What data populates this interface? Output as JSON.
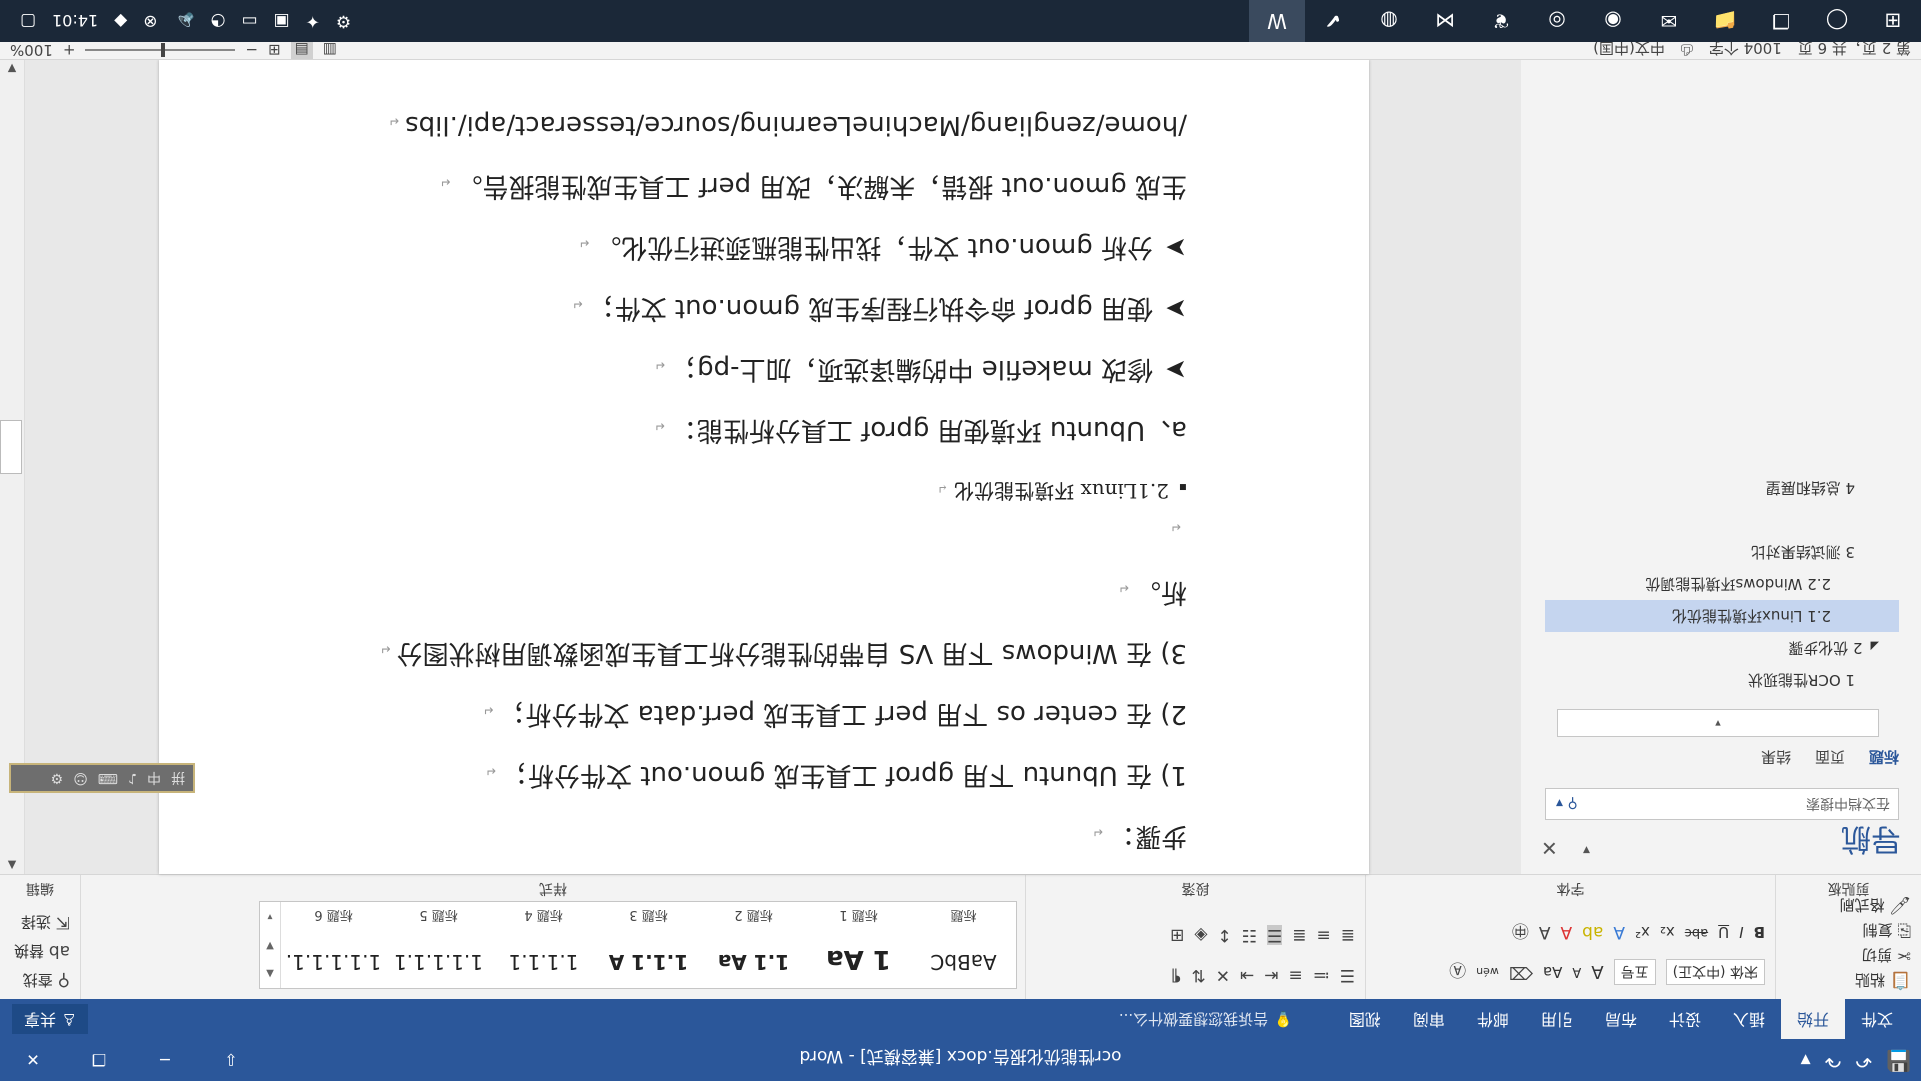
{
  "window": {
    "title": "ocr性能优化报告.docx [兼容模式] - Word",
    "qat_icons": [
      "save-icon",
      "undo-icon",
      "redo-icon",
      "customize-icon"
    ],
    "buttons": {
      "minimize": "─",
      "restore": "❐",
      "close": "✕",
      "ribbon_display": "⇩"
    }
  },
  "ribbon_tabs": {
    "tabs": [
      "文件",
      "开始",
      "插入",
      "设计",
      "布局",
      "引用",
      "邮件",
      "审阅",
      "视图"
    ],
    "active": "开始",
    "tell_me": "告诉我您想要做什么...",
    "share": "共享"
  },
  "ribbon": {
    "clipboard": {
      "label": "剪贴板",
      "paste": "粘贴",
      "cut": "剪切",
      "copy": "复制",
      "format_painter": "格式刷"
    },
    "font": {
      "label": "字体",
      "font_name": "宋体 (中文正)",
      "font_size": "五号",
      "grow": "A",
      "shrink": "A",
      "case": "Aa",
      "bold": "B",
      "italic": "I",
      "underline": "U",
      "strike": "abc",
      "sub": "x₂",
      "sup": "x²",
      "wen": "wén"
    },
    "paragraph": {
      "label": "段落"
    },
    "styles": {
      "label": "样式",
      "items": [
        {
          "preview": "AaBbC",
          "name": "标题"
        },
        {
          "preview": "1 Aa",
          "name": "标题 1"
        },
        {
          "preview": "1.1 Aa",
          "name": "标题 2"
        },
        {
          "preview": "1.1.1 A",
          "name": "标题 3"
        },
        {
          "preview": "1.1.1.1",
          "name": "标题 4"
        },
        {
          "preview": "1.1.1.1.1",
          "name": "标题 5"
        },
        {
          "preview": "1.1.1.1.1.",
          "name": "标题 6"
        }
      ]
    },
    "editing": {
      "label": "编辑",
      "find": "查找",
      "replace": "替换",
      "select": "选择"
    }
  },
  "nav_pane": {
    "title": "导航",
    "search_placeholder": "在文档中搜索",
    "tabs": [
      "标题",
      "页面",
      "结果"
    ],
    "active_tab": "标题",
    "dropdown_arrow": "▾",
    "tree": [
      {
        "label": "1 OCR性能现状",
        "indent": 1,
        "selected": false
      },
      {
        "label": "2 优化步骤",
        "indent": 0,
        "selected": false,
        "expander": "◢"
      },
      {
        "label": "2.1 Linux环境性能优化",
        "indent": 2,
        "selected": true
      },
      {
        "label": "2.2 Windows环境性能调优",
        "indent": 2,
        "selected": false
      },
      {
        "label": "3 测试结果对比",
        "indent": 1,
        "selected": false
      },
      {
        "label": "",
        "indent": 1,
        "selected": false
      },
      {
        "label": "4 总结和展望",
        "indent": 1,
        "selected": false
      }
    ]
  },
  "document": {
    "paragraphs": [
      {
        "text": "步骤：",
        "type": "p"
      },
      {
        "text": "1) 在 Ubuntu 下用 gprof 工具生成 gmon.out 文件分析；",
        "type": "p"
      },
      {
        "text": "2) 在 center os 下用 perf 工具生成 perf.data 文件分析；",
        "type": "p"
      },
      {
        "text": "3) 在 Windows 下用 VS 自带的性能分析工具生成函数调用树状图分",
        "type": "p"
      },
      {
        "text": "析。",
        "type": "p"
      },
      {
        "text": "",
        "type": "blank"
      },
      {
        "text": "2.1Linux 环境性能优化",
        "type": "h2",
        "marker": "▪"
      },
      {
        "text": "a、Ubuntu 环境使用 gprof 工具分析性能：",
        "type": "p"
      },
      {
        "text": "修改 makefile 中的编译选项，加上-pg；",
        "type": "p",
        "marker": "➤"
      },
      {
        "text": "使用 gprof 命令执行程序生成 gmon.out 文件；",
        "type": "p",
        "marker": "➤"
      },
      {
        "text": "分析 gmon.out 文件，找出性能瓶颈进行优化。",
        "type": "p",
        "marker": "➤"
      },
      {
        "text": "生成 gmon.out 报错，未解决，改用 perf 工具生成性能报告。",
        "type": "p"
      },
      {
        "text": "/home/zengliang/MachineLearning/source/tesseract/api/.libs",
        "type": "p"
      }
    ],
    "paragraph_mark": "↵"
  },
  "ime_bar": {
    "items": [
      "拼",
      "中",
      "♪",
      "⌨",
      "☺",
      "⚙"
    ]
  },
  "status_bar": {
    "page": "第 2 页，共 6 页",
    "words": "1004 个字",
    "language": "中文(中国)",
    "zoom": "100%",
    "zoom_minus": "−",
    "zoom_plus": "+"
  },
  "taskbar": {
    "clock": "14:01",
    "apps": [
      "start-icon",
      "cortana-icon",
      "taskview-icon",
      "explorer-icon",
      "mail-icon",
      "chrome-icon",
      "browser-icon",
      "evernote-icon",
      "vs-icon",
      "app-icon",
      "todo-icon",
      "word-icon"
    ]
  }
}
